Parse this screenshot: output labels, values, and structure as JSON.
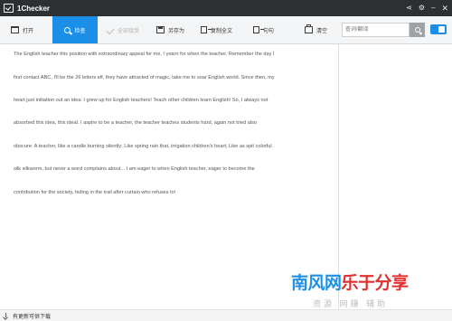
{
  "window": {
    "title": "1Checker",
    "controls": {
      "share": "⋖",
      "settings": "⚙",
      "minimize": "–",
      "close": "✕"
    }
  },
  "toolbar": {
    "open": "打开",
    "check": "检查",
    "accept_all": "全部接受",
    "save_as": "另存为",
    "copy_all": "复制全文",
    "translate": "句句",
    "clear": "清空"
  },
  "search": {
    "placeholder": "查词/翻译"
  },
  "editor": {
    "lines": [
      "The English teacher this position with extraordinary appeal for me, I yearn for when the teacher. Remember the day I",
      "first contact ABC, I'll be the 26 letters elf, they have attracted of magic, take me to soar English world. Since then, my",
      "heart just initiation out an idea: I grew up for English teachers! Teach other children learn English! So, I always not",
      "absorbed this idea, this ideal. I aspire to be a teacher, the teacher teaches students hard, again not tried also",
      "obscure. A teacher, like a candle burning silently; Like spring rain that, irrigation children's heart; Like as spit colorful",
      "silk silkworm, but never a word complains about... I am eager to when English teacher, eager to become the",
      "contribution for the society, hiding in the trail after curtain who refuses to!"
    ]
  },
  "statusbar": {
    "message": "有更新可供下载"
  },
  "watermark": {
    "part1": "南风网",
    "part2": "乐于分享",
    "subtitle": "资源 网赚 辅助"
  },
  "colors": {
    "accent": "#1b8ee8",
    "titlebar": "#2c3033"
  }
}
